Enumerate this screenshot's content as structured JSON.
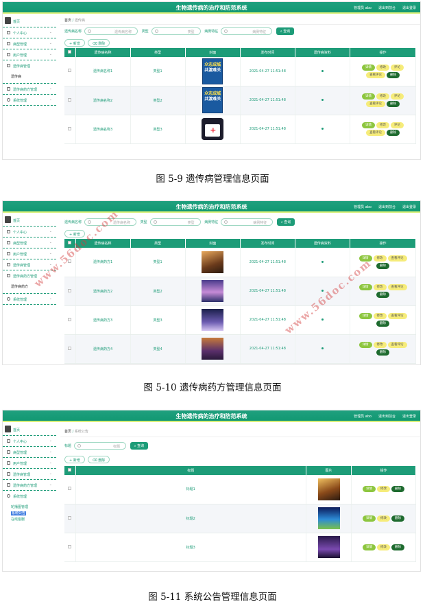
{
  "app": {
    "title": "生物遗传病的治疗和防范系统",
    "nav": [
      "管理员 abo",
      "退出到前台",
      "退出登录"
    ]
  },
  "figures": [
    {
      "caption": "图 5-9 遗传病管理信息页面",
      "sidebar": {
        "logo_text": "首页",
        "items": [
          "个人中心",
          "病型管理",
          "用户管理",
          "遗传病管理",
          "遗传病药方管理",
          "系统管理"
        ],
        "sub_items": [
          "遗传病"
        ]
      },
      "breadcrumb": {
        "home": "首页",
        "sep": "/",
        "current": "遗传病"
      },
      "search": {
        "fields": [
          {
            "label": "遗传病名称",
            "placeholder": "遗传病名称"
          },
          {
            "label": "类型",
            "placeholder": "类型"
          },
          {
            "label": "病例特征",
            "placeholder": "病例特征"
          }
        ],
        "query_label": "查询"
      },
      "actions": {
        "add_label": "新增",
        "delete_label": "删除"
      },
      "table": {
        "headers": [
          "",
          "遗传病名称",
          "类型",
          "封面",
          "发布时间",
          "遗传病资料",
          "操作"
        ],
        "rows": [
          {
            "name": "遗传病名称1",
            "type": "类型1",
            "time": "2021-04-27 11:51:48"
          },
          {
            "name": "遗传病名称2",
            "type": "类型2",
            "time": "2021-04-27 11:51:48"
          },
          {
            "name": "遗传病名称3",
            "type": "类型3",
            "time": "2021-04-27 11:51:48"
          }
        ],
        "poster_lines": [
          "众志成城",
          "共渡难关"
        ],
        "row_buttons": [
          "详情",
          "修改",
          "评论",
          "查看评论",
          "删除"
        ]
      }
    },
    {
      "caption": "图 5-10 遗传病药方管理信息页面",
      "sidebar": {
        "logo_text": "首页",
        "items": [
          "个人中心",
          "病型管理",
          "用户管理",
          "遗传病管理",
          "遗传病药方管理",
          "系统管理"
        ],
        "sub_items": [
          "遗传病药方"
        ]
      },
      "search": {
        "fields": [
          {
            "label": "遗传病名称",
            "placeholder": "遗传病名称"
          },
          {
            "label": "类型",
            "placeholder": "类型"
          },
          {
            "label": "病例特征",
            "placeholder": "病例特征"
          }
        ],
        "query_label": "查询"
      },
      "actions": {
        "add_label": "新增"
      },
      "table": {
        "headers": [
          "",
          "遗传病名称",
          "类型",
          "封面",
          "发布时间",
          "遗传病资料",
          "操作"
        ],
        "rows": [
          {
            "name": "遗传病药方1",
            "type": "类型1",
            "time": "2021-04-27 11:51:48"
          },
          {
            "name": "遗传病药方2",
            "type": "类型2",
            "time": "2021-04-27 11:51:48"
          },
          {
            "name": "遗传病药方3",
            "type": "类型3",
            "time": "2021-04-27 11:51:48"
          },
          {
            "name": "遗传病药方4",
            "type": "类型4",
            "time": "2021-04-27 11:51:48"
          }
        ],
        "row_buttons": [
          "详情",
          "修改",
          "查看评论",
          "删除"
        ]
      }
    },
    {
      "caption": "图 5-11 系统公告管理信息页面",
      "sidebar": {
        "logo_text": "首页",
        "items": [
          "个人中心",
          "病型管理",
          "用户管理",
          "遗传病管理",
          "遗传病药方管理",
          "系统管理"
        ],
        "sub_items": [
          "轮播图管理",
          "系统公告",
          "在线客服"
        ]
      },
      "breadcrumb": {
        "home": "首页",
        "sep": "/",
        "current": "系统公告"
      },
      "search": {
        "fields": [
          {
            "label": "标题",
            "placeholder": "标题"
          }
        ],
        "query_label": "查询"
      },
      "actions": {
        "add_label": "新增",
        "delete_label": "删除"
      },
      "table": {
        "headers": [
          "",
          "标题",
          "图片",
          "操作"
        ],
        "rows": [
          {
            "title": "标题1"
          },
          {
            "title": "标题2"
          },
          {
            "title": "标题3"
          }
        ],
        "row_buttons": [
          "详情",
          "修改",
          "删除"
        ]
      }
    }
  ],
  "watermark": "www.56doc.com"
}
